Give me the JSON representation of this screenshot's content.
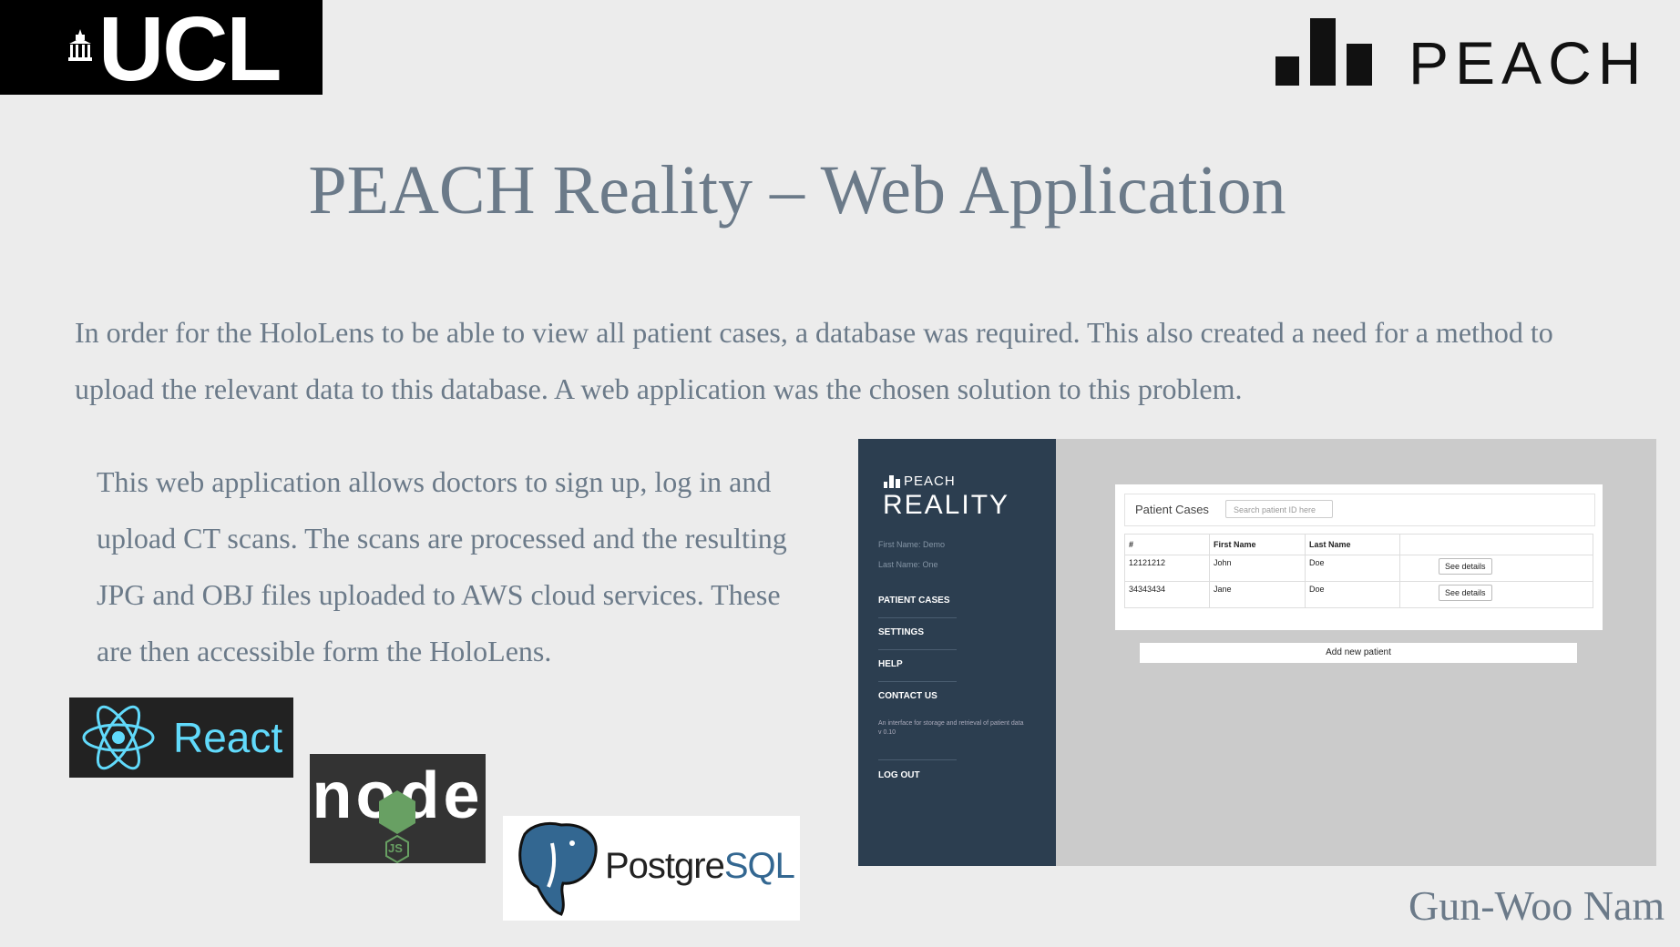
{
  "logos": {
    "ucl": "UCL",
    "peach": "PEACH",
    "react": "React",
    "node": "node",
    "node_js": "JS",
    "postgres": "Postgre",
    "postgres_sql": "SQL"
  },
  "title": "PEACH Reality – Web Application",
  "intro": "In order for the HoloLens to be able to view all patient cases, a database was required. This also created a need for a method to upload the relevant data to this database. A web application was the chosen solution to this problem.",
  "description": "This web application allows doctors to sign up, log in and upload CT scans. The scans are processed and the resulting JPG and OBJ files uploaded to AWS cloud services. These are then accessible form the HoloLens.",
  "app": {
    "brand_small": "PEACH",
    "brand_large": "REALITY",
    "first_name": "First Name: Demo",
    "last_name": "Last Name: One",
    "nav": [
      "PATIENT CASES",
      "SETTINGS",
      "HELP",
      "CONTACT US"
    ],
    "about": "An interface for storage and retrieval of patient data",
    "version": "v 0.10",
    "logout": "LOG OUT",
    "panel_title": "Patient Cases",
    "search_placeholder": "Search patient ID here",
    "columns": [
      "#",
      "First Name",
      "Last Name"
    ],
    "rows": [
      {
        "id": "12121212",
        "first": "John",
        "last": "Doe",
        "action": "See details"
      },
      {
        "id": "34343434",
        "first": "Jane",
        "last": "Doe",
        "action": "See details"
      }
    ],
    "add_button": "Add new patient"
  },
  "author": "Gun-Woo Nam",
  "colors": {
    "background": "#ececec",
    "text": "#6b7a89",
    "sidebar": "#2c3e50",
    "react": "#61dafb",
    "node_green": "#68a063",
    "postgres_blue": "#336791"
  }
}
